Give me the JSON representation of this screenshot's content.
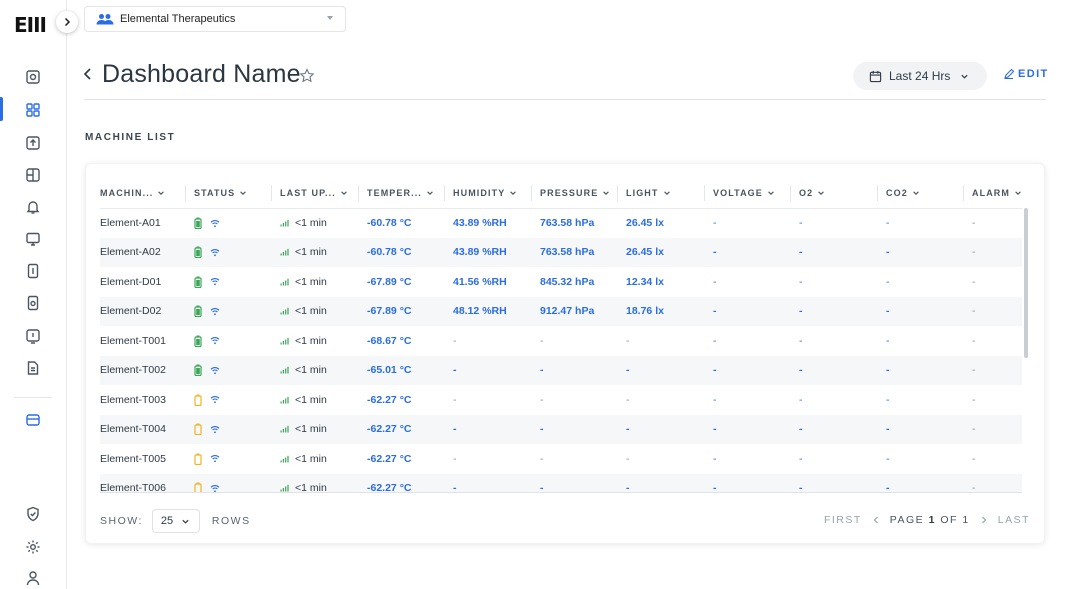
{
  "app": {
    "logo": "EIII"
  },
  "org_selector": {
    "value": "Elemental Therapeutics",
    "icon": "group-icon"
  },
  "header": {
    "title": "Dashboard Name",
    "time_range": "Last 24 Hrs",
    "edit_label": "EDIT"
  },
  "section_title": "MACHINE LIST",
  "colors": {
    "accent": "#2b6de3",
    "battery_green": "#3aa757",
    "battery_yellow": "#f2b320",
    "wifi": "#2b6de3",
    "signal": "#3aa757"
  },
  "table": {
    "columns": [
      "MACHIN...",
      "STATUS",
      "LAST UP...",
      "TEMPER...",
      "HUMIDITY",
      "PRESSURE",
      "LIGHT",
      "VOLTAGE",
      "O2",
      "CO2",
      "ALARM"
    ],
    "rows": [
      {
        "name": "Element-A01",
        "battery": "green",
        "last": "<1 min",
        "temp": "-60.78 °C",
        "humidity": "43.89 %RH",
        "pressure": "763.58 hPa",
        "light": "26.45 lx",
        "voltage": "-",
        "o2": "-",
        "co2": "-",
        "alarm": "-"
      },
      {
        "name": "Element-A02",
        "battery": "green",
        "last": "<1 min",
        "temp": "-60.78 °C",
        "humidity": "43.89 %RH",
        "pressure": "763.58 hPa",
        "light": "26.45 lx",
        "voltage": "-",
        "o2": "-",
        "co2": "-",
        "alarm": "-"
      },
      {
        "name": "Element-D01",
        "battery": "green",
        "last": "<1 min",
        "temp": "-67.89 °C",
        "humidity": "41.56 %RH",
        "pressure": "845.32 hPa",
        "light": "12.34 lx",
        "voltage": "-",
        "o2": "-",
        "co2": "-",
        "alarm": "-"
      },
      {
        "name": "Element-D02",
        "battery": "green",
        "last": "<1 min",
        "temp": "-67.89 °C",
        "humidity": "48.12 %RH",
        "pressure": "912.47 hPa",
        "light": "18.76 lx",
        "voltage": "-",
        "o2": "-",
        "co2": "-",
        "alarm": "-"
      },
      {
        "name": "Element-T001",
        "battery": "green",
        "last": "<1 min",
        "temp": "-68.67 °C",
        "humidity": "-",
        "pressure": "-",
        "light": "-",
        "voltage": "-",
        "o2": "-",
        "co2": "-",
        "alarm": "-"
      },
      {
        "name": "Element-T002",
        "battery": "green",
        "last": "<1 min",
        "temp": "-65.01 °C",
        "humidity": "-",
        "pressure": "-",
        "light": "-",
        "voltage": "-",
        "o2": "-",
        "co2": "-",
        "alarm": "-"
      },
      {
        "name": "Element-T003",
        "battery": "yellow",
        "last": "<1 min",
        "temp": "-62.27 °C",
        "humidity": "-",
        "pressure": "-",
        "light": "-",
        "voltage": "-",
        "o2": "-",
        "co2": "-",
        "alarm": "-"
      },
      {
        "name": "Element-T004",
        "battery": "yellow",
        "last": "<1 min",
        "temp": "-62.27 °C",
        "humidity": "-",
        "pressure": "-",
        "light": "-",
        "voltage": "-",
        "o2": "-",
        "co2": "-",
        "alarm": "-"
      },
      {
        "name": "Element-T005",
        "battery": "yellow",
        "last": "<1 min",
        "temp": "-62.27 °C",
        "humidity": "-",
        "pressure": "-",
        "light": "-",
        "voltage": "-",
        "o2": "-",
        "co2": "-",
        "alarm": "-"
      },
      {
        "name": "Element-T006",
        "battery": "yellow",
        "last": "<1 min",
        "temp": "-62.27 °C",
        "humidity": "-",
        "pressure": "-",
        "light": "-",
        "voltage": "-",
        "o2": "-",
        "co2": "-",
        "alarm": "-"
      }
    ]
  },
  "footer": {
    "show_label": "SHOW:",
    "rows_value": "25",
    "rows_label": "ROWS",
    "first": "FIRST",
    "page_label": "PAGE",
    "page_current": "1",
    "of_label": "OF",
    "page_total": "1",
    "last": "LAST"
  }
}
